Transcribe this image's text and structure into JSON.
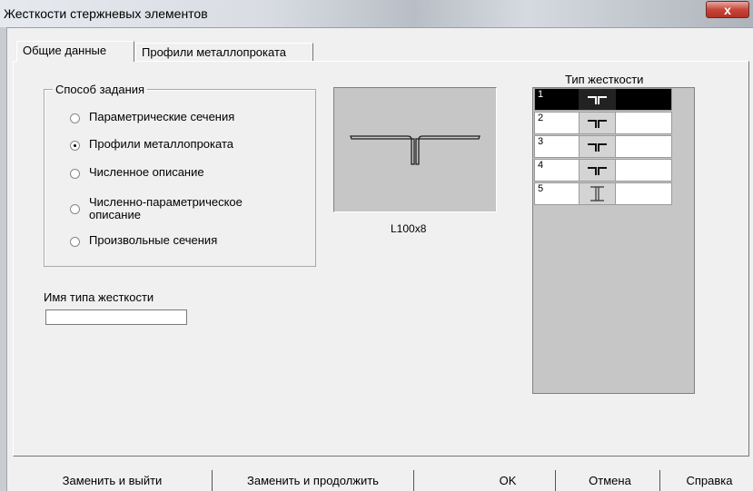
{
  "window": {
    "title": "Жесткости стержневых элементов",
    "close_glyph": "x"
  },
  "tabs": [
    {
      "label": "Общие данные",
      "active": true
    },
    {
      "label": "Профили металлопроката",
      "active": false
    }
  ],
  "method_group": {
    "label": "Способ задания",
    "options": [
      {
        "label": "Параметрические сечения",
        "checked": false
      },
      {
        "label": "Профили металлопроката",
        "checked": true
      },
      {
        "label": "Численное описание",
        "checked": false
      },
      {
        "label_line1": "Численно-параметрическое",
        "label_line2": "описание",
        "checked": false
      },
      {
        "label": "Произвольные сечения",
        "checked": false
      }
    ]
  },
  "name_field": {
    "label": "Имя типа жесткости",
    "value": ""
  },
  "preview": {
    "profile_label": "L100x8",
    "icon": "double-angle-section-icon"
  },
  "type_list": {
    "title": "Тип жесткости",
    "rows": [
      {
        "num": "1",
        "icon": "double-angle-icon",
        "selected": true
      },
      {
        "num": "2",
        "icon": "double-angle-icon",
        "selected": false
      },
      {
        "num": "3",
        "icon": "double-angle-icon",
        "selected": false
      },
      {
        "num": "4",
        "icon": "double-angle-icon",
        "selected": false
      },
      {
        "num": "5",
        "icon": "i-beam-icon",
        "selected": false
      }
    ]
  },
  "buttons": {
    "replace_exit": "Заменить и выйти",
    "replace_continue": "Заменить и продолжить",
    "ok": "OK",
    "cancel": "Отмена",
    "help": "Справка"
  },
  "colors": {
    "selected_row": "#000000",
    "preview_bg": "#c6c6c6",
    "close_button": "#c8463a"
  }
}
